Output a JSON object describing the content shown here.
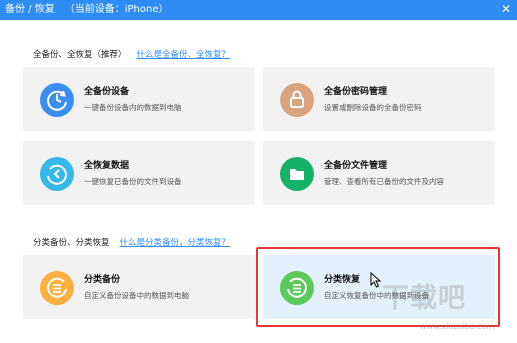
{
  "window": {
    "title": "备份 / 恢复",
    "device_label": "（当前设备：iPhone）",
    "close_glyph": "✕"
  },
  "section_full": {
    "title": "全备份、全恢复（推荐）",
    "help_link": "什么是全备份、全恢复？"
  },
  "section_category": {
    "title": "分类备份、分类恢复",
    "help_link": "什么是分类备份，分类恢复？"
  },
  "cards": {
    "full_backup": {
      "title": "全备份设备",
      "desc": "一键备份设备内的数据到电脑",
      "icon": "backup-clock-icon",
      "color": "#3a8ef0"
    },
    "password": {
      "title": "全备份密码管理",
      "desc": "设置或删除设备的全备份密码",
      "icon": "lock-icon",
      "color": "#d9a37e"
    },
    "full_restore": {
      "title": "全恢复数据",
      "desc": "一键恢复已备份的文件到设备",
      "icon": "restore-clock-icon",
      "color": "#35b7e8"
    },
    "file_manage": {
      "title": "全备份文件管理",
      "desc": "管理、查看所有已备份的文件及内容",
      "icon": "folder-icon",
      "color": "#17b26a"
    },
    "category_backup": {
      "title": "分类备份",
      "desc": "自定义备份设备中的数据到电脑",
      "icon": "list-up-icon",
      "color": "#fbb040"
    },
    "category_restore": {
      "title": "分类恢复",
      "desc": "自定义恢复备份中的数据到设备",
      "icon": "list-down-icon",
      "color": "#5cc95c"
    }
  },
  "watermark": {
    "text": "下载吧",
    "url": "www.xiazaiba.com"
  },
  "highlight_color": "#e53935"
}
